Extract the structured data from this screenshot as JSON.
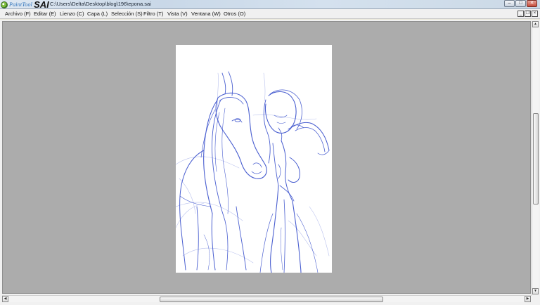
{
  "titlebar": {
    "logo_small": "PaintTool",
    "logo_large": "SAI",
    "file_path": "C:\\Users\\Delta\\Desktop\\blog\\196\\epona.sai",
    "controls": {
      "minimize": "–",
      "maximize": "□",
      "close": "✕"
    }
  },
  "menu": {
    "items": [
      {
        "label": "Archivo (F)"
      },
      {
        "label": "Editar (E)"
      },
      {
        "label": "Lienzo (C)"
      },
      {
        "label": "Capa (L)"
      },
      {
        "label": "Selección (S)"
      },
      {
        "label": "Filtro (T)"
      },
      {
        "label": "Vista (V)"
      },
      {
        "label": "Ventana (W)"
      },
      {
        "label": "Otros (O)"
      }
    ],
    "mdi_controls": {
      "minimize": "_",
      "restore": "❐",
      "close": "×"
    }
  },
  "canvas": {
    "background_color": "#acacac",
    "paper_color": "#ffffff",
    "sketch_color": "#4a5fd0",
    "content": "blue pencil sketch of a horse and a figure"
  },
  "scrollbars": {
    "vertical": {
      "up": "▲",
      "down": "▼"
    },
    "horizontal": {
      "left": "◀",
      "right": "▶"
    }
  }
}
